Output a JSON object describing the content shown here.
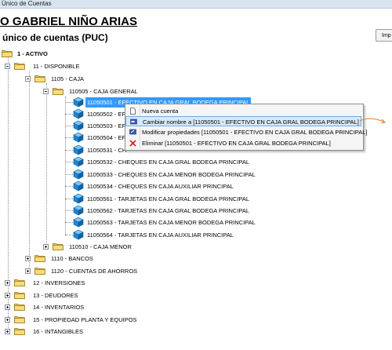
{
  "window": {
    "title": "Único de Cuentas"
  },
  "header": {
    "company": "O GABRIEL NIÑO ARIAS",
    "subtitle": "único de cuentas (PUC)",
    "print_label": "Imp"
  },
  "tree": {
    "n1": "1 - ACTIVO",
    "n11": "11 - DISPONIBLE",
    "n1105": "1105 - CAJA",
    "n110505": "110505 - CAJA GENERAL",
    "accounts": [
      "11050501 - EFECTIVO EN CAJA GRAL BODEGA PRINCIPAL",
      "11050502 - EFI",
      "11050503 - EFI",
      "11050504 - EFI",
      "11050531 - CH",
      "11050532 - CHEQUES EN CAJA GRAL BODEGA PRINCIPAL",
      "11050533 - CHEQUES EN CAJA MENOR BODEGA PRINCIPAL",
      "11050534 - CHEQUES EN CAJA AUXILIAR PRINCIPAL",
      "11050561 - TARJETAS EN CAJA GRAL BODEGA PRINCIPAL",
      "11050562 - TARJETAS EN CAJA GRAL BODEGA PRINCIPAL",
      "11050563 - TARJETAS EN CAJA MENOR BODEGA PRINCIPAL",
      "11050564 - TARJETAS EN CAJA AUXILIAR PRINCIPAL"
    ],
    "n110510": "110510 - CAJA MENOR",
    "n1110": "1110 - BANCOS",
    "n1120": "1120 - CUENTAS DE AHORROS",
    "n12": "12 - INVERSIONES",
    "n13": "13 - DEUDORES",
    "n14": "14 - INVENTARIOS",
    "n15": "15 - PROPIEDAD PLANTA Y EQUIPOS",
    "n16": "16 - INTANGIBLES"
  },
  "context_menu": {
    "new": "Nueva cuenta",
    "rename": "Cambiar nombre a [11050501 - EFECTIVO EN CAJA GRAL BODEGA PRINCIPAL]",
    "modify": "Modificar propiedades [11050501 - EFECTIVO EN CAJA GRAL BODEGA PRINCIPAL]",
    "delete": "Eliminar [11050501 - EFECTIVO EN CAJA GRAL BODEGA PRINCIPAL]"
  },
  "colors": {
    "selection": "#3399ff",
    "folder": "#f3d46a",
    "cube": "#1f86d6",
    "menu_highlight": "#d7e9fb"
  }
}
